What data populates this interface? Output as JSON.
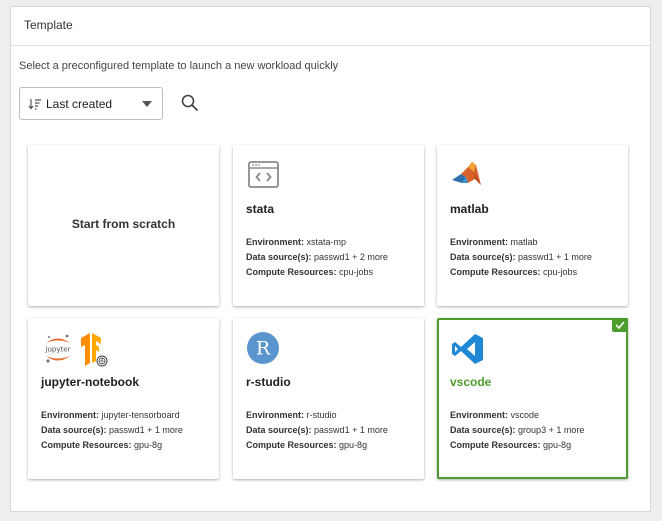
{
  "panel": {
    "title": "Template"
  },
  "subtitle": "Select a preconfigured template to launch a new workload quickly",
  "sort": {
    "label": "Last created"
  },
  "scratch": {
    "label": "Start from scratch"
  },
  "cards": [
    {
      "name": "stata",
      "icon": "code-window-icon",
      "env_label": "Environment:",
      "env": "xstata-mp",
      "ds_label": "Data source(s):",
      "ds": "passwd1 + 2 more",
      "cr_label": "Compute Resources:",
      "cr": "cpu-jobs"
    },
    {
      "name": "matlab",
      "icon": "matlab-icon",
      "env_label": "Environment:",
      "env": "matlab",
      "ds_label": "Data source(s):",
      "ds": "passwd1 + 1 more",
      "cr_label": "Compute Resources:",
      "cr": "cpu-jobs"
    },
    {
      "name": "jupyter-notebook",
      "icon": "jupyter-tensorflow-icon",
      "env_label": "Environment:",
      "env": "jupyter-tensorboard",
      "ds_label": "Data source(s):",
      "ds": "passwd1 + 1 more",
      "cr_label": "Compute Resources:",
      "cr": "gpu-8g",
      "jupyter_text": "jupyter"
    },
    {
      "name": "r-studio",
      "icon": "r-icon",
      "env_label": "Environment:",
      "env": "r-studio",
      "ds_label": "Data source(s):",
      "ds": "passwd1 + 1 more",
      "cr_label": "Compute Resources:",
      "cr": "gpu-8g",
      "r_letter": "R"
    },
    {
      "name": "vscode",
      "icon": "vscode-icon",
      "selected": true,
      "env_label": "Environment:",
      "env": "vscode",
      "ds_label": "Data source(s):",
      "ds": "group3 + 1 more",
      "cr_label": "Compute Resources:",
      "cr": "gpu-8g"
    }
  ],
  "colors": {
    "accent": "#4c9c2e",
    "r_blue": "#5b95cf",
    "vscode_blue": "#1e88d4"
  }
}
